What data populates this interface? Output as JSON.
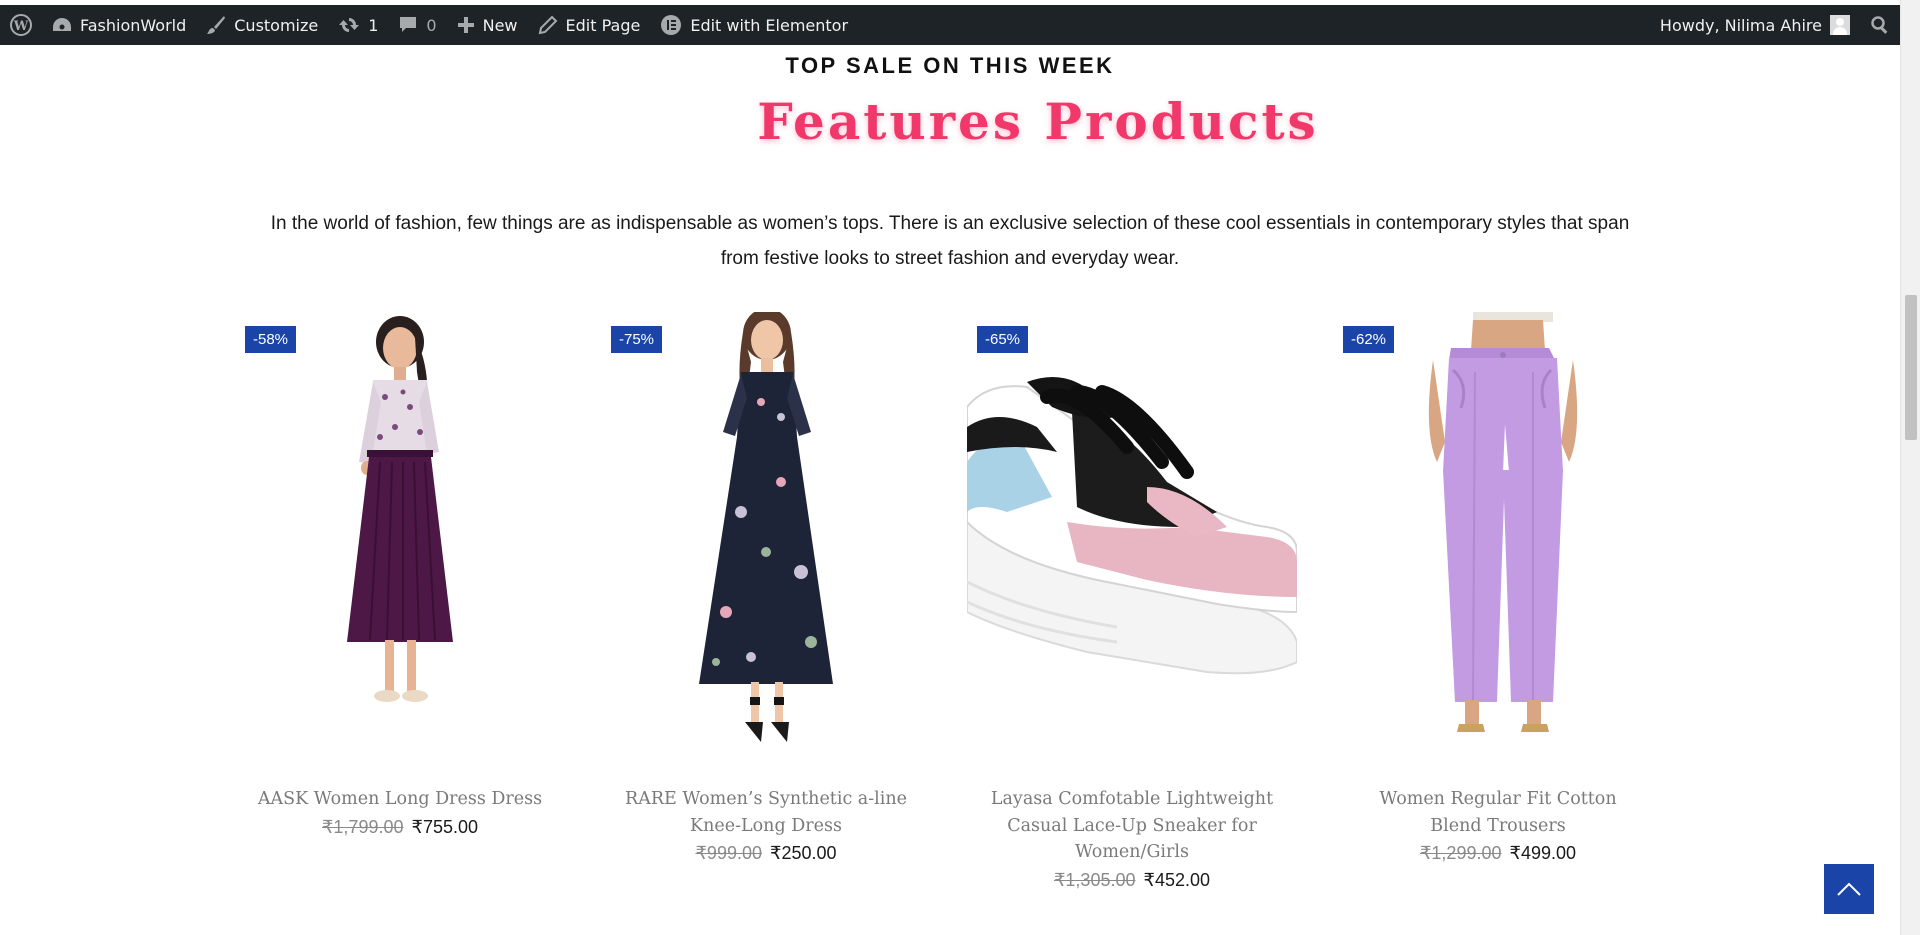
{
  "adminbar": {
    "site_name": "FashionWorld",
    "customize": "Customize",
    "updates_count": "1",
    "comments_count": "0",
    "new": "New",
    "edit_page": "Edit Page",
    "edit_elementor": "Edit with Elementor",
    "howdy": "Howdy, Nilima Ahire"
  },
  "section": {
    "eyebrow": "TOP SALE ON THIS WEEK",
    "heading": "Features Products",
    "intro": "In the world of fashion, few things are as indispensable as women’s tops. There is an exclusive selection of these cool essentials in contemporary styles that span from festive looks to street fashion and everyday wear."
  },
  "products": [
    {
      "badge": "-58%",
      "name": "AASK Women Long Dress Dress",
      "old_price": "₹1,799.00",
      "new_price": "₹755.00"
    },
    {
      "badge": "-75%",
      "name": "RARE Women’s Synthetic a-line Knee-Long Dress",
      "old_price": "₹999.00",
      "new_price": "₹250.00"
    },
    {
      "badge": "-65%",
      "name": "Layasa Comfotable Lightweight Casual Lace-Up Sneaker for Women/Girls",
      "old_price": "₹1,305.00",
      "new_price": "₹452.00"
    },
    {
      "badge": "-62%",
      "name": "Women Regular Fit Cotton Blend Trousers",
      "old_price": "₹1,299.00",
      "new_price": "₹499.00"
    }
  ],
  "colors": {
    "adminbar_bg": "#1d2327",
    "heading": "#f0386b",
    "badge": "#1b44a8",
    "to_top": "#1b44a8"
  }
}
